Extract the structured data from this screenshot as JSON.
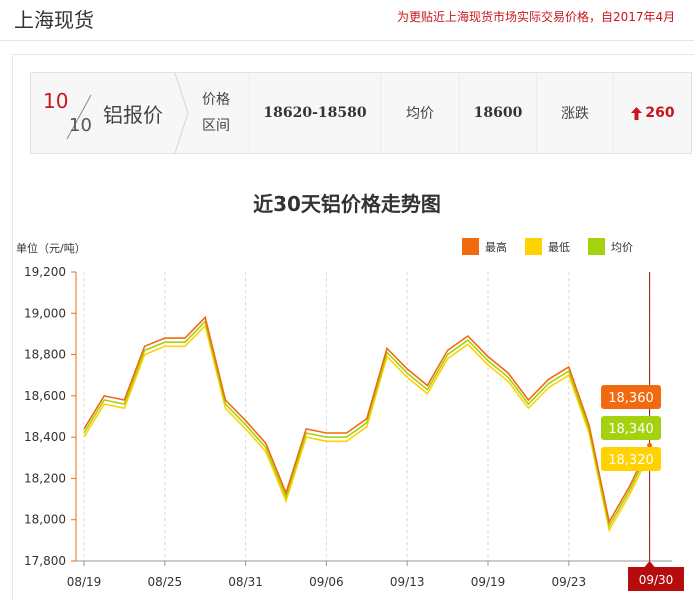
{
  "header": {
    "title": "上海现货",
    "note": "为更贴近上海现货市场实际交易价格，自2017年4月"
  },
  "price_bar": {
    "date_top": "10",
    "date_bottom": "10",
    "title": "铝报价",
    "range_label_1": "价格",
    "range_label_2": "区间",
    "range_value": "18620-18580",
    "avg_label": "均价",
    "avg_value": "18600",
    "change_label": "涨跌",
    "change_value": "260"
  },
  "colors": {
    "high": "#f26a0f",
    "low": "#ffd200",
    "avg": "#a4d20f",
    "accent": "#c8161d"
  },
  "chart_data": {
    "type": "line",
    "title": "近30天铝价格走势图",
    "ylabel": "单位（元/吨）",
    "ylim": [
      17800,
      19200
    ],
    "yticks": [
      "19,200",
      "19,000",
      "18,800",
      "18,600",
      "18,400",
      "18,200",
      "18,000",
      "17,800"
    ],
    "xtick_labels": [
      "08/19",
      "08/25",
      "08/31",
      "09/06",
      "09/13",
      "09/19",
      "09/23"
    ],
    "xtick_index": [
      0,
      4,
      8,
      12,
      16,
      20,
      24
    ],
    "grid": true,
    "legend": "top-right",
    "series": [
      {
        "name": "最高",
        "key": "high",
        "values": [
          18440,
          18600,
          18580,
          18840,
          18880,
          18880,
          18980,
          18580,
          18480,
          18370,
          18130,
          18440,
          18420,
          18420,
          18490,
          18830,
          18730,
          18650,
          18820,
          18890,
          18790,
          18710,
          18580,
          18680,
          18740,
          18460,
          17990,
          18160,
          18360
        ]
      },
      {
        "name": "最低",
        "key": "low",
        "values": [
          18400,
          18560,
          18540,
          18800,
          18840,
          18840,
          18940,
          18540,
          18440,
          18330,
          18090,
          18400,
          18380,
          18380,
          18450,
          18790,
          18690,
          18610,
          18780,
          18850,
          18750,
          18670,
          18540,
          18640,
          18700,
          18420,
          17950,
          18120,
          18320
        ]
      },
      {
        "name": "均价",
        "key": "avg",
        "values": [
          18420,
          18580,
          18560,
          18820,
          18860,
          18860,
          18960,
          18560,
          18460,
          18350,
          18110,
          18420,
          18400,
          18400,
          18470,
          18810,
          18710,
          18630,
          18800,
          18870,
          18770,
          18690,
          18560,
          18660,
          18720,
          18440,
          17970,
          18140,
          18340
        ]
      }
    ],
    "tooltip": {
      "date": "09/30",
      "high": "18,360",
      "avg": "18,340",
      "low": "18,320"
    }
  }
}
